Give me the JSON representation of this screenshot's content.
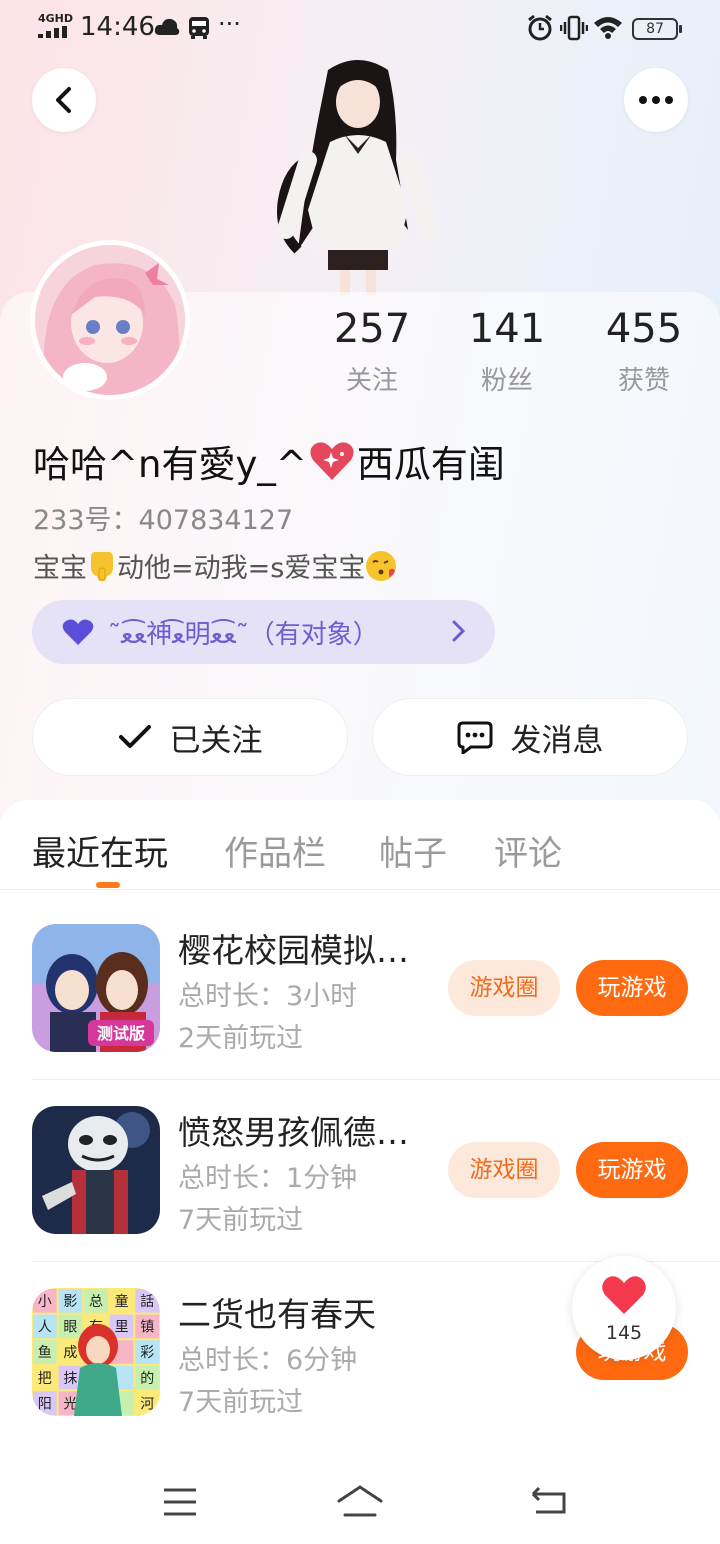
{
  "status_bar": {
    "network": "4GHD",
    "time": "14:46",
    "more": "···",
    "battery": "87"
  },
  "profile": {
    "stats": [
      {
        "value": "257",
        "label": "关注"
      },
      {
        "value": "141",
        "label": "粉丝"
      },
      {
        "value": "455",
        "label": "获赞"
      }
    ],
    "nickname": "哈哈^n有愛y_^",
    "nickname_suffix": "西瓜有闺",
    "uid": "233号：407834127",
    "bio_a": "宝宝",
    "bio_b": "动他=动我=s爱宝宝",
    "couple_text": "˜ﻌ͡ﻌ神ﻌ͡明ﻌ͡ﻌ˜（有对象）"
  },
  "actions": {
    "followed_label": "已关注",
    "message_label": "发消息"
  },
  "tabs": [
    {
      "label": "最近在玩"
    },
    {
      "label": "作品栏"
    },
    {
      "label": "帖子"
    },
    {
      "label": "评论"
    }
  ],
  "games": [
    {
      "title": "樱花校园模拟…",
      "duration": "总时长：3小时",
      "last_played": "2天前玩过",
      "circle_label": "游戏圈",
      "play_label": "玩游戏"
    },
    {
      "title": "愤怒男孩佩德…",
      "duration": "总时长：1分钟",
      "last_played": "7天前玩过",
      "circle_label": "游戏圈",
      "play_label": "玩游戏"
    },
    {
      "title": "二货也有春天",
      "duration": "总时长：6分钟",
      "last_played": "7天前玩过",
      "circle_label": "",
      "play_label": "玩游戏"
    }
  ],
  "game2_icon_chars": [
    "小",
    "影",
    "总",
    "童",
    "話",
    "人",
    "眼",
    "有",
    "里",
    "镇",
    "鱼",
    "成",
    "",
    "",
    "彩",
    "把",
    "抹",
    "",
    "",
    "的",
    "阳",
    "光",
    "",
    "",
    "河"
  ],
  "like_count": "145",
  "colors": {
    "accent": "#ff6a10",
    "accent_light": "#fde8dc",
    "couple_pill": "#e5e2f8",
    "couple_text": "#6b5ecf"
  }
}
